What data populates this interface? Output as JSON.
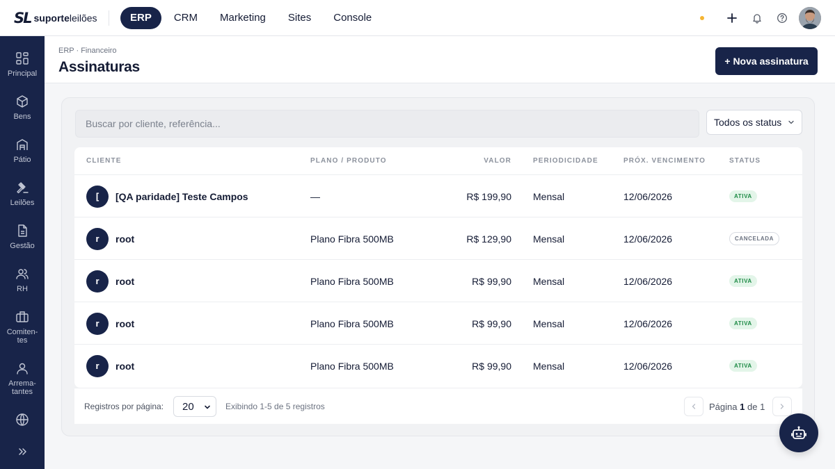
{
  "brand": {
    "mark": "SL",
    "name_bold": "suporte",
    "name_rest": "leilões"
  },
  "topnav": [
    {
      "label": "ERP",
      "active": true
    },
    {
      "label": "CRM",
      "active": false
    },
    {
      "label": "Marketing",
      "active": false
    },
    {
      "label": "Sites",
      "active": false
    },
    {
      "label": "Console",
      "active": false
    }
  ],
  "sidebar": [
    {
      "label": "Principal",
      "icon": "grid-icon"
    },
    {
      "label": "Bens",
      "icon": "box-icon"
    },
    {
      "label": "Pátio",
      "icon": "warehouse-icon"
    },
    {
      "label": "Leilões",
      "icon": "gavel-icon"
    },
    {
      "label": "Gestão",
      "icon": "document-icon"
    },
    {
      "label": "RH",
      "icon": "users-icon"
    },
    {
      "label": "Comiten-\ntes",
      "icon": "briefcase-icon"
    },
    {
      "label": "Arrema-\ntantes",
      "icon": "user-icon"
    },
    {
      "label": "",
      "icon": "globe-icon"
    }
  ],
  "page": {
    "breadcrumb": "ERP · Financeiro",
    "title": "Assinaturas",
    "new_button": "+ Nova assinatura"
  },
  "filters": {
    "search_placeholder": "Buscar por cliente, referência...",
    "status_value": "Todos os status"
  },
  "table": {
    "headers": {
      "cliente": "CLIENTE",
      "plano": "PLANO / PRODUTO",
      "valor": "VALOR",
      "periodicidade": "PERIODICIDADE",
      "vencimento": "PRÓX. VENCIMENTO",
      "status": "STATUS"
    },
    "rows": [
      {
        "initial": "[",
        "cliente": "[QA paridade] Teste Campos",
        "plano": "—",
        "valor": "R$ 199,90",
        "periodicidade": "Mensal",
        "vencimento": "12/06/2026",
        "status": "ATIVA",
        "status_kind": "ativa"
      },
      {
        "initial": "r",
        "cliente": "root",
        "plano": "Plano Fibra 500MB",
        "valor": "R$ 129,90",
        "periodicidade": "Mensal",
        "vencimento": "12/06/2026",
        "status": "CANCELADA",
        "status_kind": "cancel"
      },
      {
        "initial": "r",
        "cliente": "root",
        "plano": "Plano Fibra 500MB",
        "valor": "R$ 99,90",
        "periodicidade": "Mensal",
        "vencimento": "12/06/2026",
        "status": "ATIVA",
        "status_kind": "ativa"
      },
      {
        "initial": "r",
        "cliente": "root",
        "plano": "Plano Fibra 500MB",
        "valor": "R$ 99,90",
        "periodicidade": "Mensal",
        "vencimento": "12/06/2026",
        "status": "ATIVA",
        "status_kind": "ativa"
      },
      {
        "initial": "r",
        "cliente": "root",
        "plano": "Plano Fibra 500MB",
        "valor": "R$ 99,90",
        "periodicidade": "Mensal",
        "vencimento": "12/06/2026",
        "status": "ATIVA",
        "status_kind": "ativa"
      }
    ]
  },
  "pagination": {
    "per_page_label": "Registros por página:",
    "per_page_value": "20",
    "showing": "Exibindo 1-5 de 5 registros",
    "page_word": "Página",
    "current_page": "1",
    "of_word": "de",
    "total_pages": "1"
  },
  "colors": {
    "primary": "#182449",
    "ativa_bg": "#e3f5e9",
    "ativa_text": "#1d8a45",
    "status_dot": "#f5b532"
  }
}
